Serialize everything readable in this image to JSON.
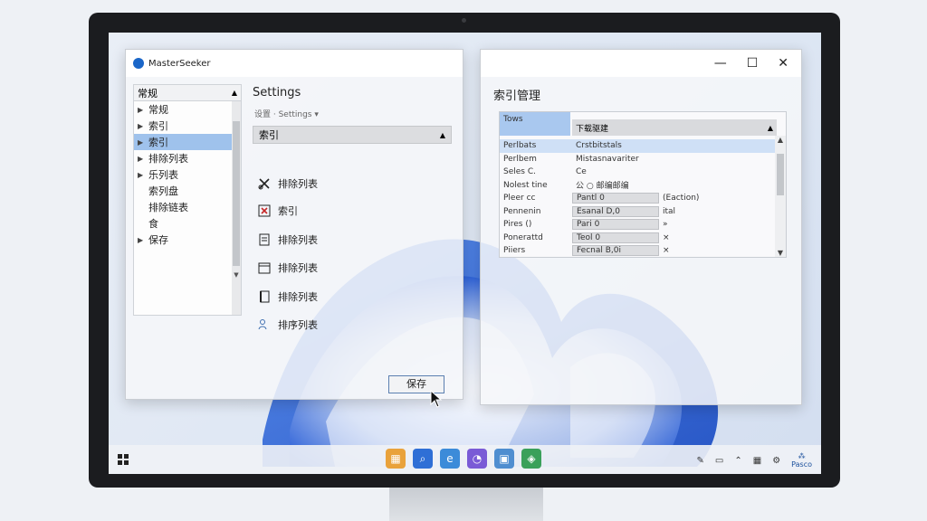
{
  "app": {
    "title": "MasterSeeker"
  },
  "tree": {
    "header": "常规",
    "items": [
      {
        "label": "常规",
        "expand": true,
        "selected": false
      },
      {
        "label": "索引",
        "expand": true,
        "selected": false
      },
      {
        "label": "索引",
        "expand": true,
        "selected": true
      },
      {
        "label": "排除列表",
        "expand": true,
        "selected": false
      },
      {
        "label": "乐列表",
        "expand": true,
        "selected": false
      },
      {
        "label": "索列盘",
        "expand": false,
        "selected": false
      },
      {
        "label": "排除链表",
        "expand": false,
        "selected": false
      },
      {
        "label": "食",
        "expand": false,
        "selected": false
      },
      {
        "label": "保存",
        "expand": true,
        "selected": false
      }
    ]
  },
  "settings": {
    "title": "Settings",
    "breadcrumb": "设置 · Settings ▾",
    "select_value": "索引",
    "options": [
      {
        "label": "排除列表",
        "icon": "scissors-icon"
      },
      {
        "label": "索引",
        "icon": "close-box-icon"
      },
      {
        "label": "排除列表",
        "icon": "document-icon"
      },
      {
        "label": "排除列表",
        "icon": "calendar-icon"
      },
      {
        "label": "排除列表",
        "icon": "book-icon"
      },
      {
        "label": "排序列表",
        "icon": "users-icon"
      }
    ],
    "save_label": "保存"
  },
  "index": {
    "title": "索引管理",
    "header_a": "Tows",
    "header_b": "下载驱建",
    "rows": [
      {
        "a": "Perlbats",
        "b": "Crstbitstals",
        "c": "",
        "selected": true,
        "boxed": false
      },
      {
        "a": "Perlbem",
        "b": "Mistasnavariter",
        "c": "",
        "selected": false,
        "boxed": false
      },
      {
        "a": "Seles C.",
        "b": "Ce",
        "c": "",
        "selected": false,
        "boxed": false
      },
      {
        "a": "Nolest tine",
        "b": "公 ○ 邮编邮编",
        "c": "",
        "selected": false,
        "boxed": false
      },
      {
        "a": "Pleer cc",
        "b": "Pantl 0",
        "c": "(Eaction)",
        "selected": false,
        "boxed": true
      },
      {
        "a": "Pennenin",
        "b": "Esanal D,0",
        "c": "ital",
        "selected": false,
        "boxed": true
      },
      {
        "a": "Pires ()",
        "b": "Pari 0",
        "c": "»",
        "selected": false,
        "boxed": true
      },
      {
        "a": "Ponerattd",
        "b": "Teol 0",
        "c": "×",
        "selected": false,
        "boxed": true
      },
      {
        "a": "Piiers",
        "b": "Fecnal B,0i",
        "c": "×",
        "selected": false,
        "boxed": true
      }
    ]
  },
  "taskbar": {
    "icons": [
      {
        "name": "photos-icon",
        "color": "#e9a23b"
      },
      {
        "name": "search-icon",
        "color": "#2f6fd6"
      },
      {
        "name": "edge-icon",
        "color": "#3c8bd9"
      },
      {
        "name": "app-icon",
        "color": "#7a5bd6"
      },
      {
        "name": "store-icon",
        "color": "#4f8ed0"
      },
      {
        "name": "shield-icon",
        "color": "#3aa05a"
      }
    ],
    "time": "Pasco"
  },
  "colors": {
    "selection": "#9fc2ec",
    "accent": "#1a66c8"
  }
}
